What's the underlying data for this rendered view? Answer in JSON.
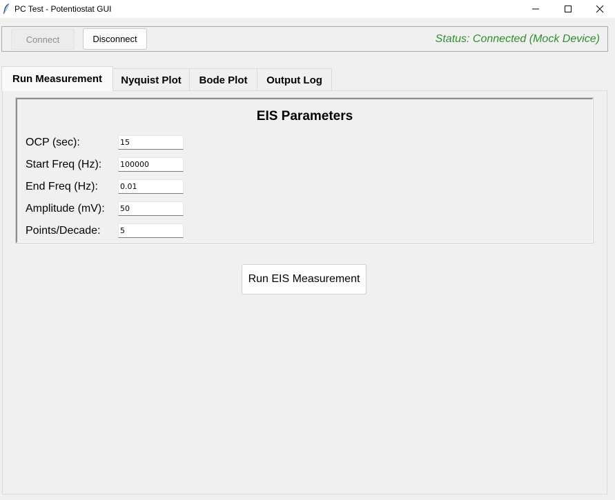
{
  "window": {
    "title": "PC Test - Potentiostat GUI",
    "controls": {
      "minimize_icon": "minimize-icon",
      "maximize_icon": "maximize-icon",
      "close_icon": "close-icon"
    }
  },
  "connection": {
    "connect_label": "Connect",
    "disconnect_label": "Disconnect",
    "status_text": "Status: Connected (Mock Device)",
    "status_color": "#2f8f2f"
  },
  "tabs": [
    {
      "label": "Run Measurement",
      "active": true
    },
    {
      "label": "Nyquist Plot",
      "active": false
    },
    {
      "label": "Bode Plot",
      "active": false
    },
    {
      "label": "Output Log",
      "active": false
    }
  ],
  "eis": {
    "title": "EIS Parameters",
    "fields": [
      {
        "label": "OCP (sec):",
        "value": "15"
      },
      {
        "label": "Start Freq (Hz):",
        "value": "100000"
      },
      {
        "label": "End Freq (Hz):",
        "value": "0.01"
      },
      {
        "label": "Amplitude (mV):",
        "value": "50"
      },
      {
        "label": "Points/Decade:",
        "value": "5"
      }
    ]
  },
  "run_button_label": "Run EIS Measurement"
}
